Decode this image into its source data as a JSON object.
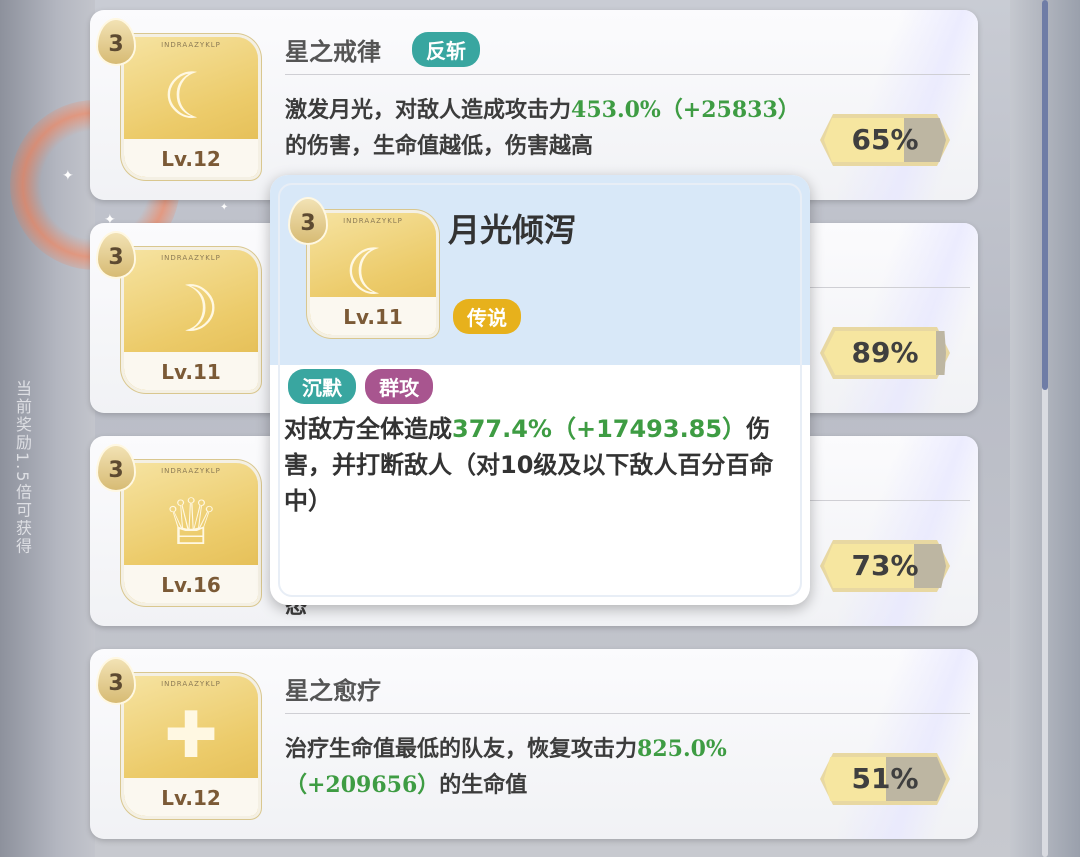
{
  "side_text": "当前奖励1.5倍可获得",
  "colors": {
    "accent_teal": "#39a6a0",
    "accent_purple": "#a8558f",
    "accent_gold": "#e7b11c",
    "highlight_green": "#3e9c43"
  },
  "skills": [
    {
      "tier": "3",
      "level": "Lv.12",
      "name": "星之戒律",
      "tag": "反斩",
      "desc_parts": [
        "激发月光，对敌人造成攻击力",
        "453.0%（+25833）",
        "的伤害，生命值越低，伤害越高"
      ],
      "percent": "65%",
      "percent_value": 65,
      "icon": "crescent-moon-icon"
    },
    {
      "tier": "3",
      "level": "Lv.11",
      "percent": "89%",
      "percent_value": 89,
      "icon": "moon-orb-icon"
    },
    {
      "tier": "3",
      "level": "Lv.16",
      "percent": "73%",
      "percent_value": 73,
      "icon": "praying-maiden-icon",
      "tail_text": "态"
    },
    {
      "tier": "3",
      "level": "Lv.12",
      "name": "星之愈疗",
      "desc_parts": [
        "治疗生命值最低的队友，恢复攻击力",
        "825.0%",
        "（+209656）",
        "的生命值"
      ],
      "percent": "51%",
      "percent_value": 51,
      "icon": "healing-cross-icon"
    }
  ],
  "popup": {
    "tier": "3",
    "level": "Lv.11",
    "title": "月光倾泻",
    "rarity": "传说",
    "tags": [
      "沉默",
      "群攻"
    ],
    "desc_pre": "对敌方全体造成",
    "desc_hl": "377.4%（+17493.85）",
    "desc_post": "伤害，并打断敌人（对10级及以下敌人百分百命中）",
    "icon": "crescent-moon-rays-icon"
  }
}
